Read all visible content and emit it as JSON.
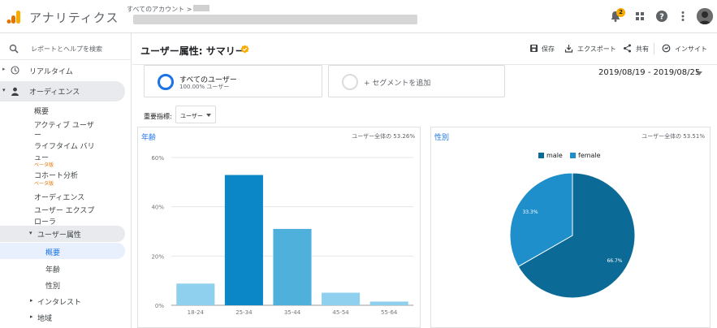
{
  "app": {
    "title": "アナリティクス",
    "account_crumb": "すべてのアカウント >",
    "notification_count": "2"
  },
  "sidebar": {
    "search_placeholder": "レポートとヘルプを検索",
    "realtime": "リアルタイム",
    "audience": "オーディエンス",
    "items": {
      "overview": "概要",
      "active_users_1": "アクティブ ユーザ",
      "active_users_2": "ー",
      "lifetime_1": "ライフタイム バリ",
      "lifetime_2": "ュー",
      "beta_label": "ベータ版",
      "cohort": "コホート分析",
      "audiences": "オーディエンス",
      "user_explorer_1": "ユーザー エクスプ",
      "user_explorer_2": "ローラ",
      "demographics": "ユーザー属性",
      "demo_overview": "概要",
      "demo_age": "年齢",
      "demo_gender": "性別",
      "interests": "インタレスト",
      "geo": "地域"
    }
  },
  "header": {
    "title": "ユーザー属性: サマリー",
    "save": "保存",
    "export": "エクスポート",
    "share": "共有",
    "insight": "インサイト"
  },
  "segments": {
    "all_users": "すべてのユーザー",
    "all_users_pct": "100.00% ユーザー",
    "add_segment": "+ セグメントを追加"
  },
  "date_range": "2019/08/19 - 2019/08/25",
  "metric": {
    "label": "重要指標:",
    "value": "ユーザー"
  },
  "colors": {
    "accent": "#1a73e8",
    "male": "#0b6a96",
    "female": "#1f8fcc"
  },
  "age_card": {
    "title": "年齢",
    "share_note": "ユーザー全体の 53.26%",
    "chart_data": {
      "type": "bar",
      "categories": [
        "18-24",
        "25-34",
        "35-44",
        "45-54",
        "55-64"
      ],
      "values": [
        8.8,
        52.9,
        31,
        5.1,
        1.5
      ],
      "ylim": [
        0,
        60
      ],
      "yticks": [
        "60%",
        "40%",
        "20%",
        "0%"
      ],
      "ytick_values": [
        60,
        40,
        20,
        0
      ],
      "colors": [
        "#8fd0ee",
        "#0b87c7",
        "#4fb0dc",
        "#8fd0ee",
        "#8fd0ee"
      ]
    }
  },
  "gender_card": {
    "title": "性別",
    "share_note": "ユーザー全体の 53.51%",
    "chart_data": {
      "type": "pie",
      "labels": [
        "male",
        "female"
      ],
      "values": [
        66.7,
        33.3
      ],
      "value_labels": [
        "66.7%",
        "33.3%"
      ],
      "legend_position": "top-center"
    }
  }
}
